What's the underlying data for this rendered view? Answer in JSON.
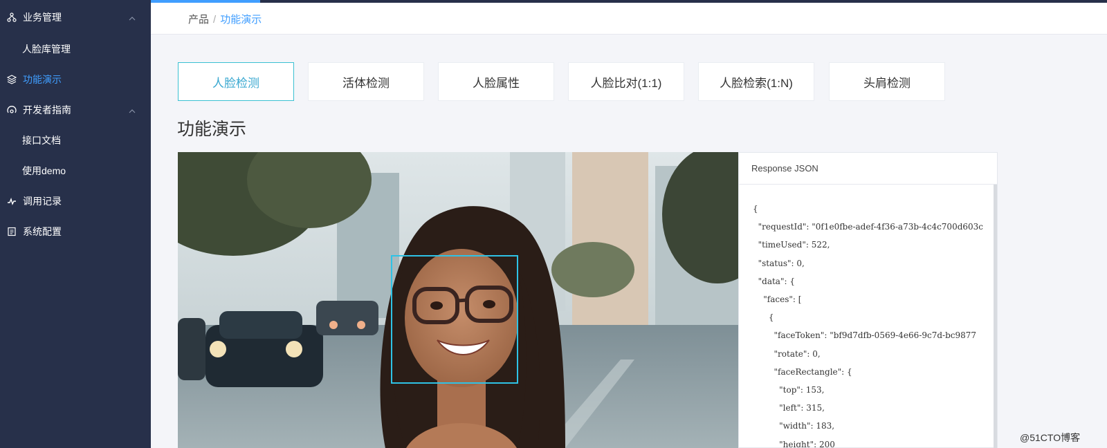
{
  "sidebar": {
    "items": [
      {
        "label": "业务管理",
        "icon": "network-icon"
      },
      {
        "label": "人脸库管理"
      },
      {
        "label": "功能演示",
        "icon": "layers-icon"
      },
      {
        "label": "开发者指南",
        "icon": "location-icon"
      },
      {
        "label": "接口文档"
      },
      {
        "label": "使用demo"
      },
      {
        "label": "调用记录",
        "icon": "pulse-icon"
      },
      {
        "label": "系统配置",
        "icon": "document-icon"
      }
    ]
  },
  "breadcrumb": {
    "root": "产品",
    "separator": "/",
    "current": "功能演示"
  },
  "tabs": [
    "人脸检测",
    "活体检测",
    "人脸属性",
    "人脸比对(1:1)",
    "人脸检索(1:N)",
    "头肩检测"
  ],
  "section_title": "功能演示",
  "json_panel": {
    "title": "Response JSON",
    "content": "{\n  \"requestId\": \"0f1e0fbe-adef-4f36-a73b-4c4c700d603c\n  \"timeUsed\": 522,\n  \"status\": 0,\n  \"data\": {\n    \"faces\": [\n      {\n        \"faceToken\": \"bf9d7dfb-0569-4e66-9c7d-bc9877\n        \"rotate\": 0,\n        \"faceRectangle\": {\n          \"top\": 153,\n          \"left\": 315,\n          \"width\": 183,\n          \"height\": 200"
  },
  "watermark": "@51CTO博客",
  "colors": {
    "sidebar_bg": "#27304a",
    "accent": "#409eff",
    "tab_active": "#39c0d2",
    "face_box": "#2ec3e6"
  }
}
